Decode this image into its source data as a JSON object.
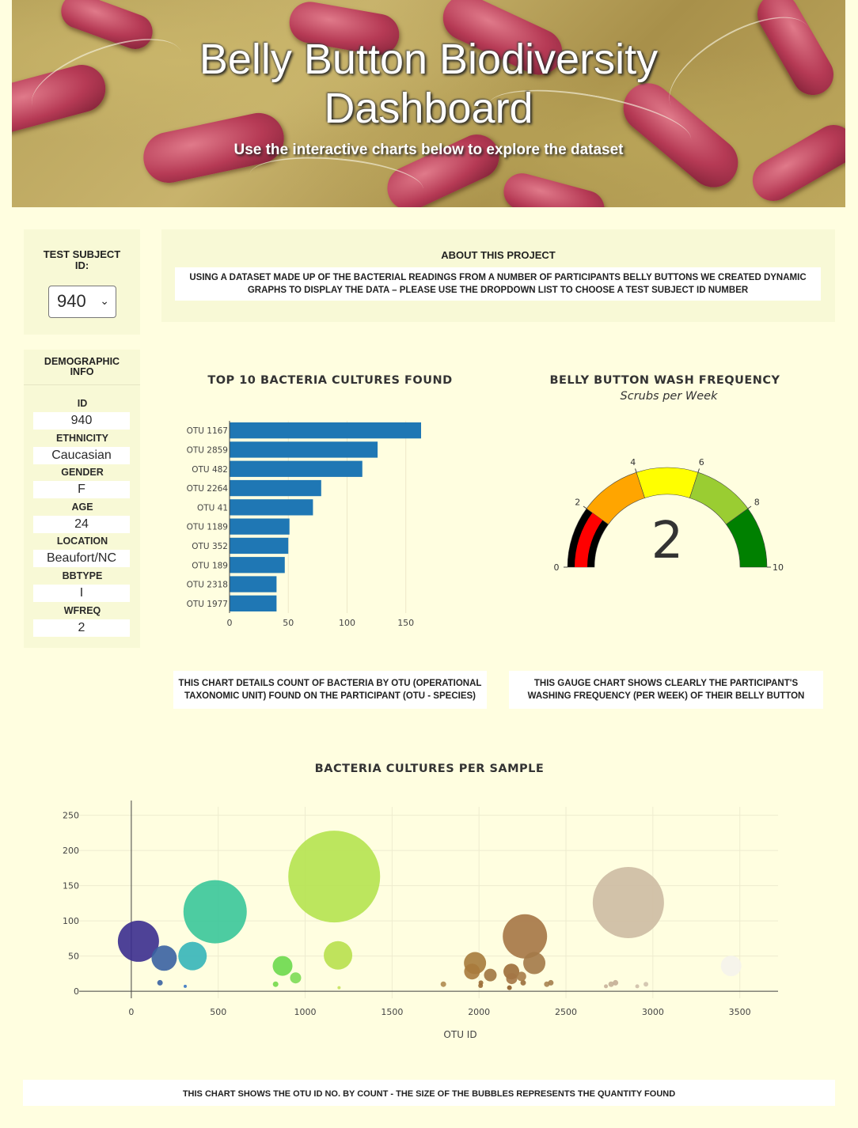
{
  "header": {
    "title_line1": "Belly Button Biodiversity",
    "title_line2": "Dashboard",
    "subtitle": "Use the interactive charts below to explore the dataset"
  },
  "selector": {
    "label": "TEST SUBJECT ID:",
    "selected": "940"
  },
  "about": {
    "title": "ABOUT THIS PROJECT",
    "text": "USING A DATASET MADE UP OF THE BACTERIAL READINGS FROM A NUMBER OF PARTICIPANTS BELLY BUTTONS WE CREATED DYNAMIC GRAPHS TO DISPLAY THE DATA – PLEASE USE THE DROPDOWN LIST TO CHOOSE A TEST SUBJECT ID NUMBER"
  },
  "demographics": {
    "title": "DEMOGRAPHIC INFO",
    "rows": [
      {
        "label": "ID",
        "value": "940"
      },
      {
        "label": "ETHNICITY",
        "value": "Caucasian"
      },
      {
        "label": "GENDER",
        "value": "F"
      },
      {
        "label": "AGE",
        "value": "24"
      },
      {
        "label": "LOCATION",
        "value": "Beaufort/NC"
      },
      {
        "label": "BBTYPE",
        "value": "I"
      },
      {
        "label": "WFREQ",
        "value": "2"
      }
    ]
  },
  "notes": {
    "bar": "THIS CHART DETAILS COUNT OF BACTERIA BY OTU (OPERATIONAL TAXONOMIC UNIT) FOUND ON THE PARTICIPANT (OTU - SPECIES)",
    "gauge": "THIS GAUGE CHART SHOWS CLEARLY THE PARTICIPANT'S WASHING FREQUENCY (PER WEEK) OF THEIR BELLY BUTTON",
    "bubble": "THIS CHART SHOWS THE OTU ID NO. BY COUNT - THE SIZE OF THE BUBBLES REPRESENTS THE QUANTITY FOUND"
  },
  "chart_data": [
    {
      "type": "bar",
      "orientation": "horizontal",
      "title": "TOP 10 BACTERIA CULTURES FOUND",
      "categories": [
        "OTU 1167",
        "OTU 2859",
        "OTU 482",
        "OTU 2264",
        "OTU 41",
        "OTU 1189",
        "OTU 352",
        "OTU 189",
        "OTU 2318",
        "OTU 1977"
      ],
      "values": [
        163,
        126,
        113,
        78,
        71,
        51,
        50,
        47,
        40,
        40
      ],
      "color": "#1f77b4",
      "xlim": [
        0,
        170
      ],
      "xticks": [
        0,
        50,
        100,
        150
      ]
    },
    {
      "type": "gauge",
      "title": "BELLY BUTTON WASH FREQUENCY",
      "subtitle": "Scrubs per Week",
      "value": 2,
      "range": [
        0,
        10
      ],
      "ticks": [
        0,
        2,
        4,
        6,
        8,
        10
      ],
      "bands": [
        {
          "from": 0,
          "to": 2,
          "color": "#000000"
        },
        {
          "from": 2,
          "to": 4,
          "color": "#ffa500"
        },
        {
          "from": 4,
          "to": 6,
          "color": "#ffff00"
        },
        {
          "from": 6,
          "to": 8,
          "color": "#9acd32"
        },
        {
          "from": 8,
          "to": 10,
          "color": "#008000"
        }
      ],
      "bar_color": "#ff0000"
    },
    {
      "type": "scatter",
      "title": "BACTERIA CULTURES PER SAMPLE",
      "xlabel": "OTU ID",
      "ylabel": "",
      "xlim": [
        -300,
        3720
      ],
      "ylim": [
        -10,
        262
      ],
      "xticks": [
        0,
        500,
        1000,
        1500,
        2000,
        2500,
        3000,
        3500
      ],
      "yticks": [
        0,
        50,
        100,
        150,
        200,
        250
      ],
      "points": [
        {
          "x": 41,
          "y": 71,
          "r": 26,
          "color": "#3b2e8f"
        },
        {
          "x": 189,
          "y": 47,
          "r": 16,
          "color": "#3a62a2"
        },
        {
          "x": 165,
          "y": 12,
          "r": 3.5,
          "color": "#3a62a2"
        },
        {
          "x": 310,
          "y": 7,
          "r": 2,
          "color": "#3a77c4"
        },
        {
          "x": 352,
          "y": 50,
          "r": 18,
          "color": "#35b5b9"
        },
        {
          "x": 482,
          "y": 113,
          "r": 40,
          "color": "#3ac79a"
        },
        {
          "x": 870,
          "y": 36,
          "r": 12.5,
          "color": "#6bd94c"
        },
        {
          "x": 945,
          "y": 19,
          "r": 7,
          "color": "#7ddb56"
        },
        {
          "x": 830,
          "y": 10,
          "r": 3.5,
          "color": "#74d94b"
        },
        {
          "x": 1167,
          "y": 163,
          "r": 58,
          "color": "#b5e350"
        },
        {
          "x": 1189,
          "y": 51,
          "r": 18,
          "color": "#b8e04e"
        },
        {
          "x": 1195,
          "y": 5,
          "r": 2,
          "color": "#c7e25e"
        },
        {
          "x": 1795,
          "y": 10,
          "r": 3.5,
          "color": "#b08b50"
        },
        {
          "x": 1977,
          "y": 40,
          "r": 14,
          "color": "#a67b3c"
        },
        {
          "x": 1960,
          "y": 28,
          "r": 10,
          "color": "#a87a3c"
        },
        {
          "x": 2009,
          "y": 8,
          "r": 3,
          "color": "#9a6b35"
        },
        {
          "x": 2011,
          "y": 12,
          "r": 3,
          "color": "#9a6b35"
        },
        {
          "x": 2065,
          "y": 23,
          "r": 8,
          "color": "#a07641"
        },
        {
          "x": 2186,
          "y": 28,
          "r": 10,
          "color": "#9c6d39"
        },
        {
          "x": 2188,
          "y": 18,
          "r": 7,
          "color": "#a47545"
        },
        {
          "x": 2175,
          "y": 5,
          "r": 3,
          "color": "#8e5d2a"
        },
        {
          "x": 2254,
          "y": 12,
          "r": 3.5,
          "color": "#9a6e3d"
        },
        {
          "x": 2244,
          "y": 21,
          "r": 6,
          "color": "#a77c48"
        },
        {
          "x": 2264,
          "y": 78,
          "r": 28,
          "color": "#a57545"
        },
        {
          "x": 2318,
          "y": 40,
          "r": 14,
          "color": "#a37948"
        },
        {
          "x": 2390,
          "y": 10,
          "r": 3.5,
          "color": "#a98452"
        },
        {
          "x": 2413,
          "y": 12,
          "r": 3.5,
          "color": "#a47d4c"
        },
        {
          "x": 2730,
          "y": 7,
          "r": 2.5,
          "color": "#c8b19a"
        },
        {
          "x": 2760,
          "y": 10,
          "r": 3.5,
          "color": "#c5b097"
        },
        {
          "x": 2785,
          "y": 12,
          "r": 3.5,
          "color": "#c4ae96"
        },
        {
          "x": 2859,
          "y": 126,
          "r": 45,
          "color": "#cdbba3"
        },
        {
          "x": 2910,
          "y": 7,
          "r": 2.5,
          "color": "#cfbfaa"
        },
        {
          "x": 2960,
          "y": 10,
          "r": 3,
          "color": "#d0c2ad"
        },
        {
          "x": 3450,
          "y": 36,
          "r": 13,
          "color": "#f5f3ec"
        }
      ]
    }
  ]
}
